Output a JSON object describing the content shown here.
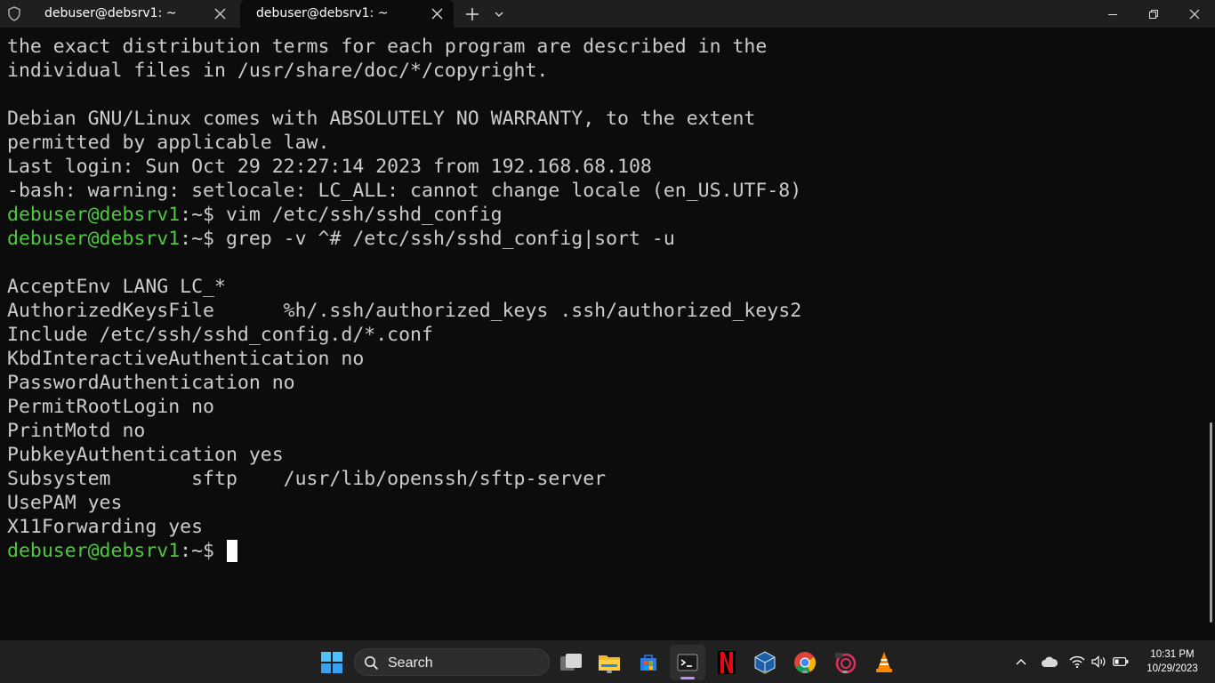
{
  "titlebar": {
    "tabs": [
      {
        "label": "debuser@debsrv1: ~",
        "active": false
      },
      {
        "label": "debuser@debsrv1: ~",
        "active": true
      }
    ]
  },
  "terminal": {
    "lines": [
      "the exact distribution terms for each program are described in the",
      "individual files in /usr/share/doc/*/copyright.",
      "",
      "Debian GNU/Linux comes with ABSOLUTELY NO WARRANTY, to the extent",
      "permitted by applicable law.",
      "Last login: Sun Oct 29 22:27:14 2023 from 192.168.68.108",
      "-bash: warning: setlocale: LC_ALL: cannot change locale (en_US.UTF-8)"
    ],
    "prompt_user": "debuser@debsrv1",
    "prompt_path": ":~$",
    "cmd1": " vim /etc/ssh/sshd_config",
    "cmd2": " grep -v ^# /etc/ssh/sshd_config|sort -u",
    "output": [
      "",
      "AcceptEnv LANG LC_*",
      "AuthorizedKeysFile      %h/.ssh/authorized_keys .ssh/authorized_keys2",
      "Include /etc/ssh/sshd_config.d/*.conf",
      "KbdInteractiveAuthentication no",
      "PasswordAuthentication no",
      "PermitRootLogin no",
      "PrintMotd no",
      "PubkeyAuthentication yes",
      "Subsystem       sftp    /usr/lib/openssh/sftp-server",
      "UsePAM yes",
      "X11Forwarding yes"
    ]
  },
  "taskbar": {
    "search_label": "Search",
    "time": "10:31 PM",
    "date": "10/29/2023",
    "apps": [
      "start-icon",
      "task-view-icon",
      "file-explorer-icon",
      "store-icon",
      "terminal-icon",
      "netflix-icon",
      "virtualbox-icon",
      "chrome-icon",
      "app-icon",
      "vlc-icon"
    ]
  },
  "colors": {
    "prompt": "#4ec83f",
    "text": "#cccccc",
    "background": "#0c0c0c"
  }
}
